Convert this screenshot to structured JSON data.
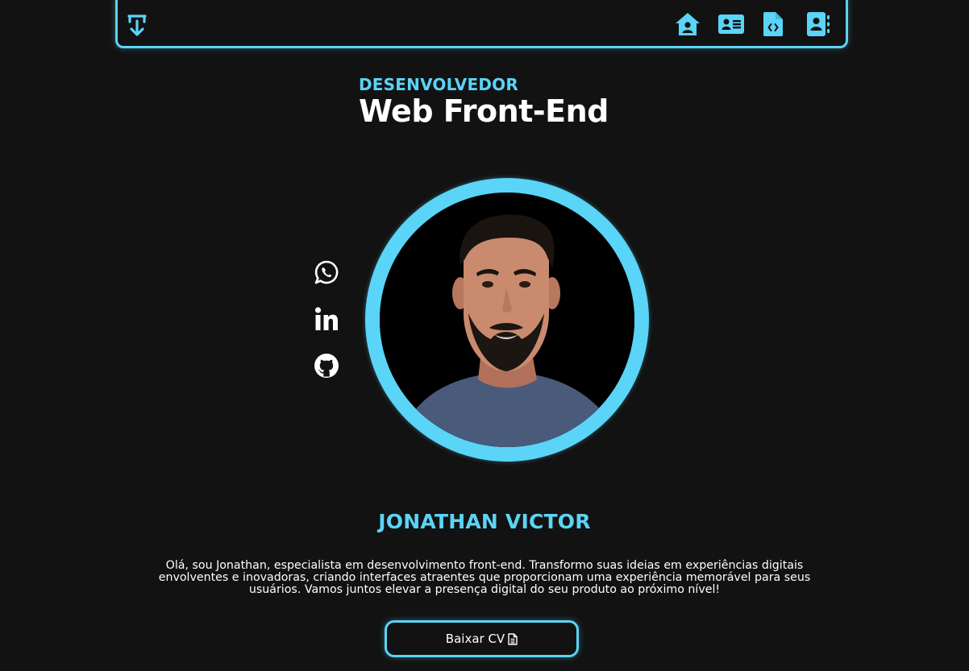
{
  "nav": {
    "download_icon": "download-icon",
    "items": [
      {
        "icon": "home-icon"
      },
      {
        "icon": "id-card-icon"
      },
      {
        "icon": "file-code-icon"
      },
      {
        "icon": "contact-book-icon"
      }
    ]
  },
  "hero": {
    "subtitle": "DESENVOLVEDOR",
    "title": "Web Front-End"
  },
  "social": [
    {
      "icon": "whatsapp-icon"
    },
    {
      "icon": "linkedin-icon"
    },
    {
      "icon": "github-icon"
    }
  ],
  "profile": {
    "name": "JONATHAN VICTOR",
    "bio": "Olá, sou Jonathan, especialista em desenvolvimento front-end. Transformo suas ideias em experiências digitais envolventes e inovadoras, criando interfaces atraentes que proporcionam uma experiência memorável para seus usuários. Vamos juntos elevar a presença digital do seu produto ao próximo nível!",
    "cv_button_label": "Baixar CV",
    "cv_icon": "file-icon"
  },
  "colors": {
    "accent": "#5ad4f7",
    "background": "#121212",
    "text": "#ffffff"
  }
}
